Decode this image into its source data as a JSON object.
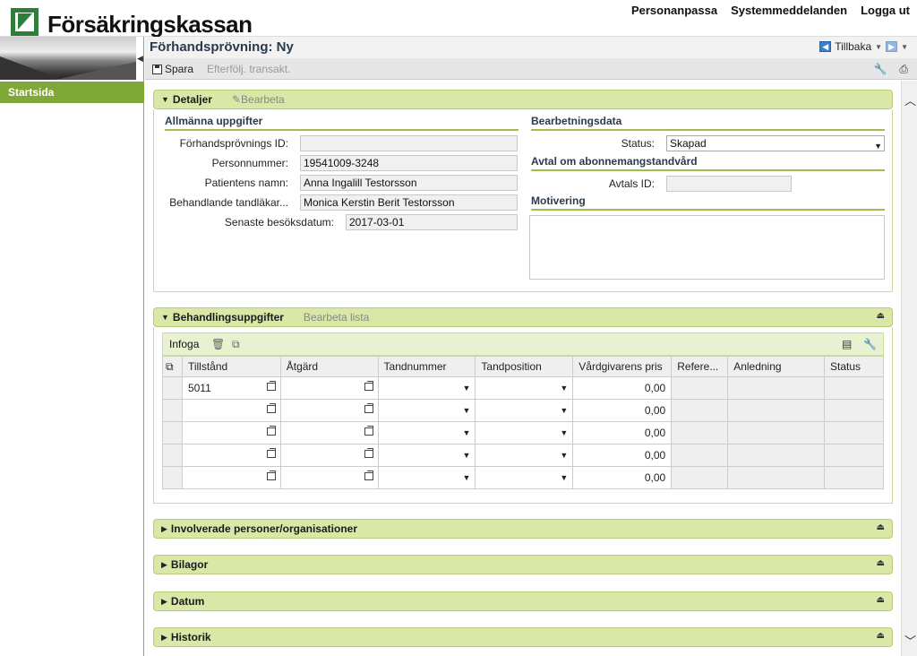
{
  "header": {
    "brand": "Försäkringskassan",
    "links": [
      "Personanpassa",
      "Systemmeddelanden",
      "Logga ut"
    ]
  },
  "nav": {
    "start": "Startsida"
  },
  "page": {
    "title": "Förhandsprövning: Ny",
    "back_label": "Tillbaka"
  },
  "toolbar": {
    "save": "Spara",
    "follow": "Efterfölj. transakt."
  },
  "details": {
    "title": "Detaljer",
    "edit": "Bearbeta",
    "general_title": "Allmänna uppgifter",
    "fields": [
      {
        "label": "Förhandsprövnings ID:",
        "value": ""
      },
      {
        "label": "Personnummer:",
        "value": "19541009-3248"
      },
      {
        "label": "Patientens namn:",
        "value": "Anna Ingalill Testorsson"
      },
      {
        "label": "Behandlande tandläkar...",
        "value": "Monica Kerstin Berit Testorsson"
      },
      {
        "label": "Senaste besöksdatum:",
        "value": "2017-03-01"
      }
    ],
    "processing_title": "Bearbetningsdata",
    "status_label": "Status:",
    "status_value": "Skapad",
    "agreement_title": "Avtal om abonnemangstandvård",
    "agreement_id_label": "Avtals ID:",
    "agreement_id_value": "",
    "motivation_title": "Motivering"
  },
  "treatment": {
    "title": "Behandlingsuppgifter",
    "edit_list": "Bearbeta lista",
    "insert": "Infoga",
    "columns": [
      "Tillstånd",
      "Åtgärd",
      "Tandnummer",
      "Tandposition",
      "Vårdgivarens pris",
      "Refere...",
      "Anledning",
      "Status"
    ],
    "rows": [
      {
        "tillstand": "5011",
        "pris": "0,00"
      },
      {
        "tillstand": "",
        "pris": "0,00"
      },
      {
        "tillstand": "",
        "pris": "0,00"
      },
      {
        "tillstand": "",
        "pris": "0,00"
      },
      {
        "tillstand": "",
        "pris": "0,00"
      }
    ]
  },
  "sections": [
    "Involverade personer/organisationer",
    "Bilagor",
    "Datum",
    "Historik"
  ]
}
